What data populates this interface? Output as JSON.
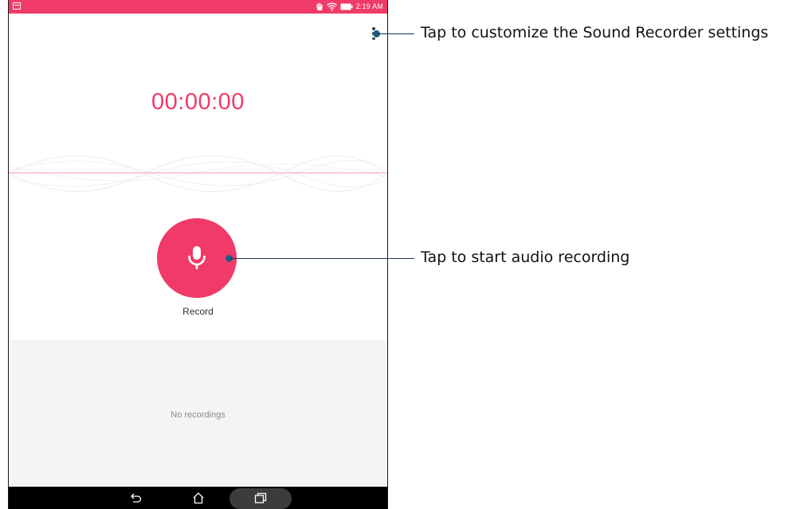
{
  "status_bar": {
    "time": "2:19 AM",
    "icons": [
      "notification-icon",
      "hand-icon",
      "wifi-icon",
      "battery-icon"
    ]
  },
  "recorder": {
    "timer": "00:00:00",
    "record_label": "Record",
    "empty_text": "No recordings",
    "accent_color": "#f03a67"
  },
  "nav_bar": {
    "icons": [
      "back-icon",
      "home-icon",
      "recent-apps-icon"
    ]
  },
  "callouts": {
    "settings": "Tap to customize the Sound Recorder settings",
    "record": "Tap to start audio recording"
  }
}
